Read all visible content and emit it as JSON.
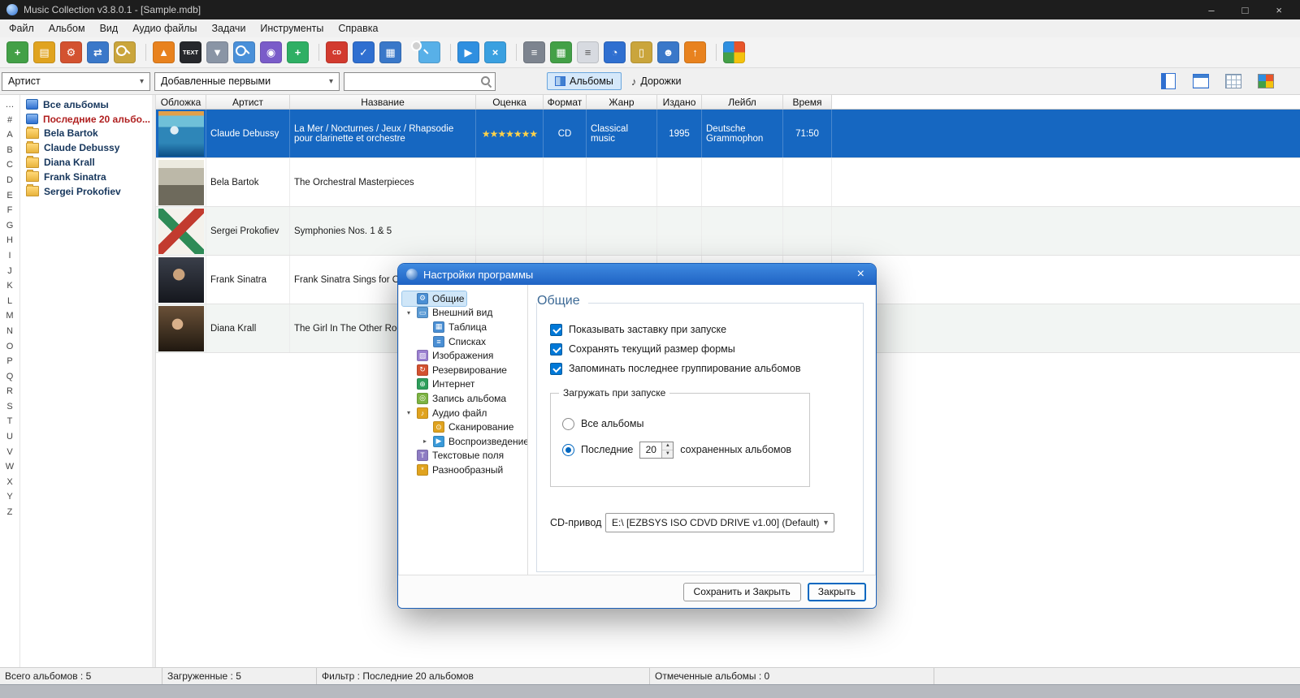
{
  "icons": {
    "chevron_down": "▾",
    "spin_up": "▲",
    "spin_down": "▼",
    "note": "♪"
  },
  "window": {
    "title": "Music Collection v3.8.0.1 - [Sample.mdb]",
    "controls": [
      {
        "name": "minimize-button",
        "glyph": "–"
      },
      {
        "name": "maximize-button",
        "glyph": "□"
      },
      {
        "name": "close-button",
        "glyph": "×"
      }
    ]
  },
  "menu": {
    "items": [
      {
        "name": "menu-file",
        "label": "Файл"
      },
      {
        "name": "menu-album",
        "label": "Альбом"
      },
      {
        "name": "menu-view",
        "label": "Вид"
      },
      {
        "name": "menu-audio-files",
        "label": "Аудио файлы"
      },
      {
        "name": "menu-tasks",
        "label": "Задачи"
      },
      {
        "name": "menu-tools",
        "label": "Инструменты"
      },
      {
        "name": "menu-help",
        "label": "Справка"
      }
    ]
  },
  "toolbar": {
    "icons": [
      {
        "name": "add-album-icon",
        "glyph": "+",
        "bg": "#43a047"
      },
      {
        "name": "duplicate-album-icon",
        "glyph": "▤",
        "bg": "#e0a31f"
      },
      {
        "name": "edit-album-icon",
        "glyph": "⚙",
        "bg": "#d35230"
      },
      {
        "name": "move-album-icon",
        "glyph": "⇄",
        "bg": "#3a78c9"
      },
      {
        "name": "find-album-icon",
        "glyph": "",
        "bg": "#caa53c",
        "shape": "mag"
      },
      {
        "name": "eject-cd-icon",
        "glyph": "▲",
        "bg": "#e8821e",
        "sep": true
      },
      {
        "name": "cd-text-icon",
        "glyph": "TEXT",
        "bg": "#26282c",
        "shape": "tiny"
      },
      {
        "name": "save-to-disc-icon",
        "glyph": "▼",
        "bg": "#8a95a5"
      },
      {
        "name": "search-disc-icon",
        "glyph": "",
        "bg": "#4a90d9",
        "shape": "mag"
      },
      {
        "name": "import-media-icon",
        "glyph": "◉",
        "bg": "#7a5cc9"
      },
      {
        "name": "add-to-list-icon",
        "glyph": "+",
        "bg": "#2faf64"
      },
      {
        "name": "cd-player-icon",
        "glyph": "CD",
        "bg": "#d23b2f",
        "shape": "tiny",
        "sep": true
      },
      {
        "name": "edit-data-icon",
        "glyph": "✓",
        "bg": "#2f6fd0"
      },
      {
        "name": "table-search-icon",
        "glyph": "▦",
        "bg": "#3a78c9"
      },
      {
        "name": "preview-icon",
        "glyph": "",
        "bg": "#58b0e8",
        "shape": "mag",
        "sep": true
      },
      {
        "name": "play-icon",
        "glyph": "▶",
        "bg": "#2f8fe0",
        "sep": true
      },
      {
        "name": "transfer-icon",
        "glyph": "×",
        "bg": "#3aa0e0"
      },
      {
        "name": "print-icon",
        "glyph": "≡",
        "bg": "#7d848f",
        "sep": true
      },
      {
        "name": "report-icon",
        "glyph": "▦",
        "bg": "#43a047"
      },
      {
        "name": "document-icon",
        "glyph": "≡",
        "bg": "#d7dae0",
        "fg": "#555"
      },
      {
        "name": "statistics-icon",
        "glyph": "◔",
        "bg": "#2f6fd0"
      },
      {
        "name": "clipboard-icon",
        "glyph": "▯",
        "bg": "#caa53c"
      },
      {
        "name": "contacts-icon",
        "glyph": "☻",
        "bg": "#3a78c9"
      },
      {
        "name": "export-user-icon",
        "glyph": "↑",
        "bg": "#e8821e"
      },
      {
        "name": "windows-colors-icon",
        "glyph": "",
        "bg": "",
        "shape": "win4",
        "sep": true
      }
    ]
  },
  "filterbar": {
    "group_value": "Артист",
    "sort_value": "Добавленные первыми",
    "search_value": "",
    "albums_label": "Альбомы",
    "albums_active": true,
    "tracks_label": "Дорожки",
    "view_buttons": [
      {
        "name": "report-view-button",
        "iconname": "report-view-icon",
        "icon": "vb-page"
      },
      {
        "name": "table-view-button",
        "iconname": "table-view-icon",
        "icon": "vb-table"
      },
      {
        "name": "grid-view-button",
        "iconname": "grid-view-icon",
        "icon": "vb-grid"
      },
      {
        "name": "card-view-button",
        "iconname": "card-view-icon",
        "icon": "vb-colors"
      }
    ]
  },
  "alphabet": [
    "…",
    "#",
    "A",
    "B",
    "C",
    "D",
    "E",
    "F",
    "G",
    "H",
    "I",
    "J",
    "K",
    "L",
    "M",
    "N",
    "O",
    "P",
    "Q",
    "R",
    "S",
    "T",
    "U",
    "V",
    "W",
    "X",
    "Y",
    "Z"
  ],
  "tree": {
    "items": [
      {
        "name": "tree-item-all-albums",
        "label": "Все альбомы",
        "icon": "albums-db-icon",
        "kind": "db"
      },
      {
        "name": "tree-item-last-20",
        "label": "Последние 20 альбо...",
        "icon": "recent-db-icon",
        "kind": "db",
        "selected": true
      },
      {
        "name": "tree-item-bela-bartok",
        "label": "Bela Bartok",
        "icon": "folder-icon",
        "kind": "folder"
      },
      {
        "name": "tree-item-claude-debussy",
        "label": "Claude Debussy",
        "icon": "folder-icon",
        "kind": "folder"
      },
      {
        "name": "tree-item-diana-krall",
        "label": "Diana Krall",
        "icon": "folder-icon",
        "kind": "folder"
      },
      {
        "name": "tree-item-frank-sinatra",
        "label": "Frank Sinatra",
        "icon": "folder-icon",
        "kind": "folder"
      },
      {
        "name": "tree-item-sergei-prokofiev",
        "label": "Sergei Prokofiev",
        "icon": "folder-icon",
        "kind": "folder"
      }
    ]
  },
  "table": {
    "columns": [
      {
        "label": "Обложка",
        "cls": "c0"
      },
      {
        "label": "Артист",
        "cls": "c1"
      },
      {
        "label": "Название",
        "cls": "c2"
      },
      {
        "label": "Оценка",
        "cls": "c3"
      },
      {
        "label": "Формат",
        "cls": "c4"
      },
      {
        "label": "Жанр",
        "cls": "c5"
      },
      {
        "label": "Издано",
        "cls": "c6"
      },
      {
        "label": "Лейбл",
        "cls": "c7"
      },
      {
        "label": "Время",
        "cls": "c8"
      }
    ],
    "rows": [
      {
        "cover": "cover-debussy",
        "artist": "Claude Debussy",
        "title": "La Mer / Nocturnes / Jeux / Rhapsodie pour clarinette et orchestre",
        "rating": "★★★★★★★",
        "format": "CD",
        "genre": "Classical music",
        "year": "1995",
        "label": "Deutsche Grammophon",
        "time": "71:50",
        "selected": true
      },
      {
        "cover": "cover-bartok",
        "artist": "Bela Bartok",
        "title": "The Orchestral Masterpieces",
        "rating": "",
        "format": "",
        "genre": "",
        "year": "",
        "label": "",
        "time": ""
      },
      {
        "cover": "cover-prokofiev",
        "artist": "Sergei Prokofiev",
        "title": "Symphonies Nos. 1 & 5",
        "rating": "",
        "format": "",
        "genre": "",
        "year": "",
        "label": "",
        "time": ""
      },
      {
        "cover": "cover-sinatra",
        "artist": "Frank Sinatra",
        "title": "Frank Sinatra Sings for Only",
        "rating": "",
        "format": "",
        "genre": "",
        "year": "",
        "label": "",
        "time": ""
      },
      {
        "cover": "cover-krall",
        "artist": "Diana Krall",
        "title": "The Girl In The Other Room",
        "rating": "",
        "format": "",
        "genre": "",
        "year": "",
        "label": "",
        "time": ""
      }
    ]
  },
  "dialog": {
    "title": "Настройки программы",
    "close_glyph": "×",
    "tree": [
      {
        "name": "settings-general",
        "label": "Общие",
        "icon": "gear-icon",
        "glyph": "⚙",
        "bg": "#4a8fd4",
        "lvl": "lvl1",
        "selected": true,
        "expander": ""
      },
      {
        "name": "settings-appearance",
        "label": "Внешний вид",
        "icon": "display-icon",
        "glyph": "▭",
        "bg": "#5b9bd5",
        "lvl": "lvl1",
        "expander": "▾"
      },
      {
        "name": "settings-table",
        "label": "Таблица",
        "icon": "table-icon",
        "glyph": "▦",
        "bg": "#4a8fd4",
        "lvl": "lvl2",
        "expander": ""
      },
      {
        "name": "settings-lists",
        "label": "Списках",
        "icon": "list-icon",
        "glyph": "≡",
        "bg": "#4a8fd4",
        "lvl": "lvl2",
        "expander": ""
      },
      {
        "name": "settings-images",
        "label": "Изображения",
        "icon": "image-icon",
        "glyph": "▨",
        "bg": "#9a7fd0",
        "lvl": "lvl1",
        "expander": ""
      },
      {
        "name": "settings-backup",
        "label": "Резервирование",
        "icon": "backup-icon",
        "glyph": "↻",
        "bg": "#d35230",
        "lvl": "lvl1",
        "expander": ""
      },
      {
        "name": "settings-internet",
        "label": "Интернет",
        "icon": "globe-icon",
        "glyph": "⊕",
        "bg": "#2e9e5b",
        "lvl": "lvl1",
        "expander": ""
      },
      {
        "name": "settings-album-recording",
        "label": "Запись альбома",
        "icon": "burn-icon",
        "glyph": "◎",
        "bg": "#7cb342",
        "lvl": "lvl1",
        "expander": ""
      },
      {
        "name": "settings-audio-file",
        "label": "Аудио файл",
        "icon": "audio-folder-icon",
        "glyph": "♪",
        "bg": "#e0a31f",
        "lvl": "lvl1",
        "expander": "▾"
      },
      {
        "name": "settings-scanning",
        "label": "Сканирование",
        "icon": "scan-icon",
        "glyph": "⊙",
        "bg": "#e0a31f",
        "lvl": "lvl2",
        "expander": ""
      },
      {
        "name": "settings-playback",
        "label": "Воспроизведение",
        "icon": "play-icon",
        "glyph": "▶",
        "bg": "#3a9ad9",
        "lvl": "lvl2",
        "expander": "▸"
      },
      {
        "name": "settings-text-fields",
        "label": "Текстовые поля",
        "icon": "text-fields-icon",
        "glyph": "T",
        "bg": "#8e7cc3",
        "lvl": "lvl1",
        "expander": ""
      },
      {
        "name": "settings-miscellaneous",
        "label": "Разнообразный",
        "icon": "misc-icon",
        "glyph": "*",
        "bg": "#e0a31f",
        "lvl": "lvl1",
        "expander": ""
      }
    ],
    "content": {
      "heading": "Общие",
      "checkboxes": [
        {
          "name": "checkbox-show-splash",
          "label": "Показывать заставку при запуске",
          "checked": true
        },
        {
          "name": "checkbox-save-form-size",
          "label": "Сохранять текущий размер формы",
          "checked": true
        },
        {
          "name": "checkbox-remember-grouping",
          "label": "Запоминать последнее группирование альбомов",
          "checked": true
        }
      ],
      "group_legend": "Загружать при запуске",
      "radio_all": "Все альбомы",
      "radio_all_on": false,
      "radio_last": "Последние",
      "radio_last_on": true,
      "spinner_value": "20",
      "spinner_suffix": "сохраненных альбомов",
      "cd_label": "CD-привод",
      "cd_value": "E:\\ [EZBSYS ISO CDVD DRIVE v1.00]  (Default)",
      "save_label": "Сохранить и Закрыть",
      "close_label": "Закрыть"
    }
  },
  "statusbar": {
    "items": [
      {
        "name": "status-total-albums",
        "text": "Всего альбомов : 5",
        "cls": "sw1"
      },
      {
        "name": "status-loaded",
        "text": "Загруженные : 5",
        "cls": "sw2"
      },
      {
        "name": "status-filter",
        "text": "Фильтр : Последние 20 альбомов",
        "cls": "sw3"
      },
      {
        "name": "status-marked-albums",
        "text": "Отмеченные альбомы : 0",
        "cls": "sw4"
      }
    ]
  }
}
